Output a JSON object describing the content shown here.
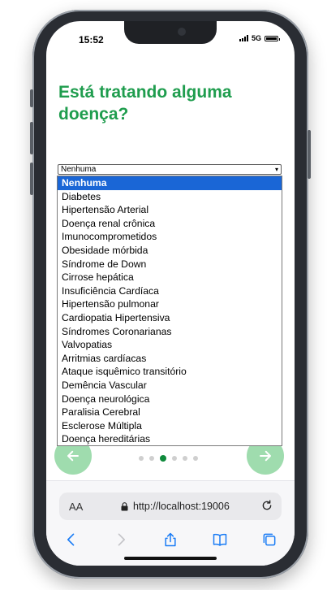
{
  "status_bar": {
    "time": "15:52",
    "network": "5G"
  },
  "question": "Está tratando alguma doença?",
  "select": {
    "selected": "Nenhuma",
    "options": [
      "Nenhuma",
      "Diabetes",
      "Hipertensão Arterial",
      "Doença renal crônica",
      "Imunocomprometidos",
      "Obesidade mórbida",
      "Síndrome de Down",
      "Cirrose hepática",
      "Insuficiência Cardíaca",
      "Hipertensão pulmonar",
      "Cardiopatia Hipertensiva",
      "Síndromes Coronarianas",
      "Valvopatias",
      "Arritmias cardíacas",
      "Ataque isquêmico transitório",
      "Demência Vascular",
      "Doença neurológica",
      "Paralisia Cerebral",
      "Esclerose Múltipla",
      "Doença hereditárias"
    ]
  },
  "pager": {
    "total": 6,
    "active_index": 2
  },
  "browser": {
    "text_size_label": "AA",
    "url": "http://localhost:19006"
  },
  "colors": {
    "accent": "#1f9d4e",
    "nav_button": "#9fdcae",
    "selected_option": "#1a66d6"
  },
  "icons": {
    "prev": "arrow-left-icon",
    "next": "arrow-right-icon",
    "lock": "lock-icon",
    "reload": "reload-icon",
    "back": "chevron-left-icon",
    "forward": "chevron-right-icon",
    "share": "share-icon",
    "bookmarks": "book-icon",
    "tabs": "tabs-icon"
  }
}
